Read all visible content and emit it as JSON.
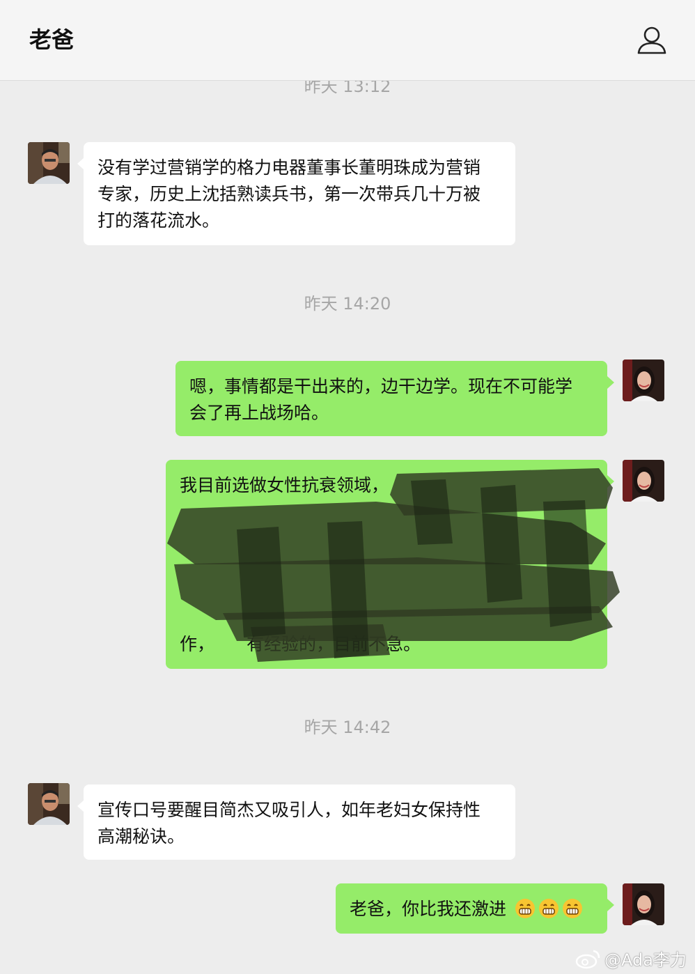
{
  "header": {
    "title": "老爸",
    "profile_icon": "person-icon"
  },
  "timestamps": {
    "partial": "昨天 13:12",
    "t1": "昨天 14:20",
    "t2": "昨天 14:42"
  },
  "messages": [
    {
      "side": "in",
      "lines": [
        "没有学过营销学的格力电器董事长董明珠成为营销",
        "专家，历史上沈括熟读兵书，第一次带兵几十万被",
        "打的落花流水。"
      ]
    },
    {
      "side": "out",
      "lines": [
        "嗯，事情都是干出来的，边干边学。现在不可能学",
        "会了再上战场哈。"
      ]
    },
    {
      "side": "out",
      "lines": [
        "我目前选做女性抗衰领域，",
        "作，",
        "有经验的，目前不急。"
      ]
    },
    {
      "side": "in",
      "lines": [
        "宣传口号要醒目简杰又吸引人，如年老妇女保持性",
        "高潮秘诀。"
      ]
    },
    {
      "side": "out",
      "lines": [
        "老爸，你比我还激进"
      ],
      "emoji": [
        "grin-emoji",
        "grin-emoji",
        "grin-emoji"
      ]
    }
  ],
  "watermark": "@Ada李力",
  "colors": {
    "incoming": "#ffffff",
    "outgoing": "#95ec69",
    "background": "#ededed"
  }
}
